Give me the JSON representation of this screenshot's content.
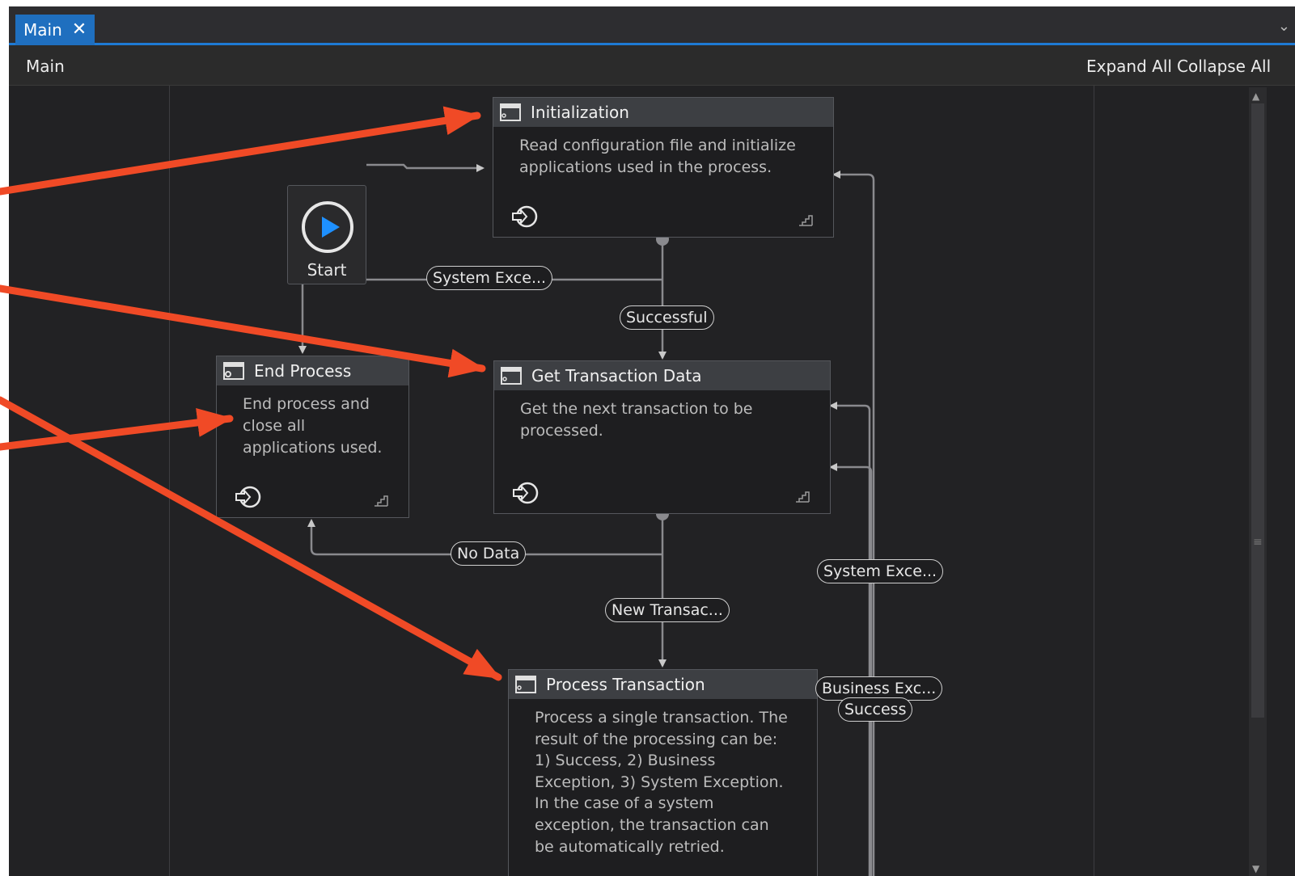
{
  "tabs": [
    {
      "label": "Main",
      "close": "✕"
    }
  ],
  "tab_dropdown": "⌄",
  "header": {
    "breadcrumb": "Main",
    "expand_all": "Expand All",
    "collapse_all": "Collapse All"
  },
  "start": {
    "label": "Start"
  },
  "activities": {
    "initialization": {
      "title": "Initialization",
      "description": "Read configuration file and initialize applications used in the process."
    },
    "get_transaction_data": {
      "title": "Get Transaction Data",
      "description": "Get the next transaction to be processed."
    },
    "end_process": {
      "title": "End Process",
      "description": "End process and close all applications used."
    },
    "process_transaction": {
      "title": "Process Transaction",
      "description": "Process a single transaction. The result of the processing can be: 1) Success, 2) Business Exception, 3) System Exception. In the case of a system exception, the transaction can be automatically retried."
    }
  },
  "transitions": {
    "system_exception_1": "System Exce...",
    "successful": "Successful",
    "no_data": "No Data",
    "new_transaction": "New Transac...",
    "system_exception_2": "System Exce...",
    "business_exception": "Business Exc...",
    "success": "Success"
  },
  "annotation_color": "#f04a26"
}
